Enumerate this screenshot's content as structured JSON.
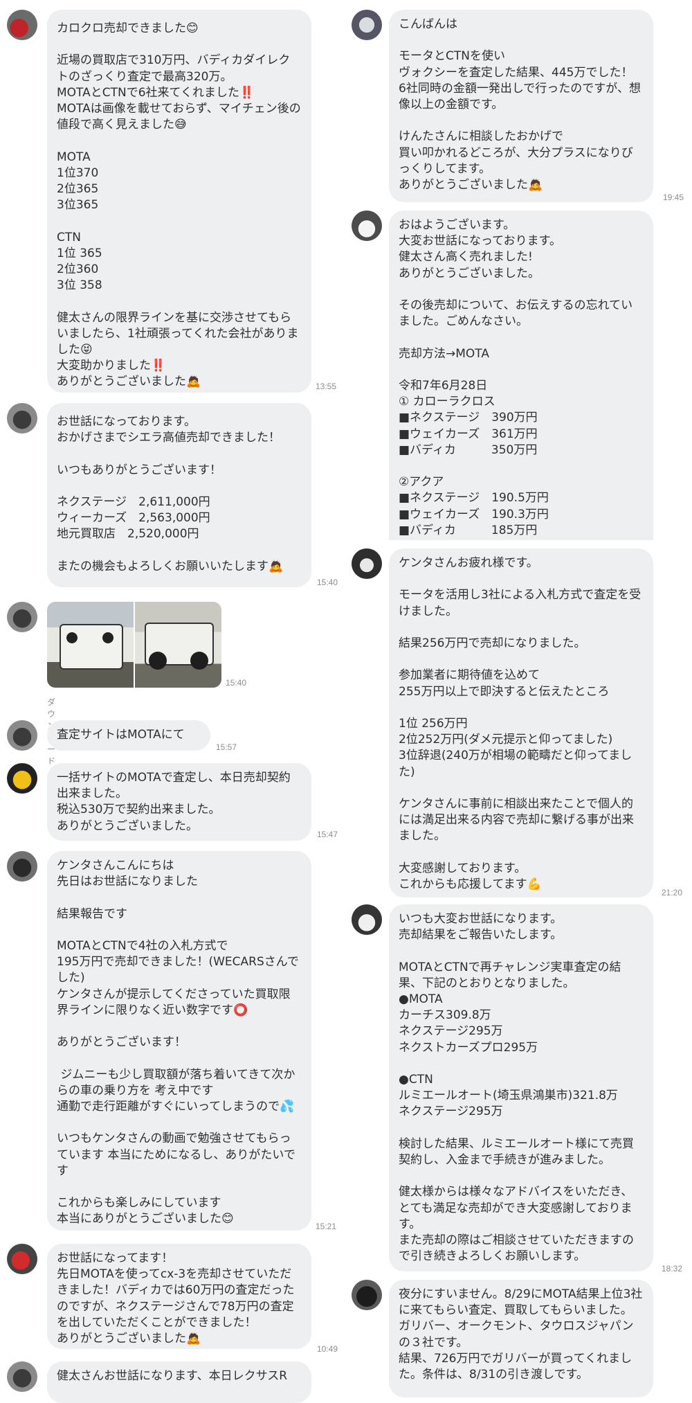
{
  "left": [
    {
      "avatar": "avatar-red-car",
      "text": "カロクロ売却できました😊\n\n近場の買取店で310万円、バディカダイレクトのざっくり査定で最高320万。\nMOTAとCTNで6社来てくれました‼️\nMOTAは画像を載せておらず、マイチェン後の値段で高く見えました😅\n\nMOTA\n1位370\n2位365\n3位365\n\nCTN\n1位 365\n2位360\n3位 358\n\n健太さんの限界ラインを基に交渉させてもらいましたら、1社頑張ってくれた会社がありました😝\n大変助かりました‼️\nありがとうございました🙇",
      "time": "13:55"
    },
    {
      "avatar": "avatar-dark-car",
      "text": "お世話になっております。\nおかげさまでシエラ高値売却できました！\n\nいつもありがとうございます！\n\nネクステージ　2,611,000円\nウィーカーズ　2,563,000円\n地元買取店　2,520,000円\n\nまたの機会もよろしくお願いいたします🙇",
      "time": "15:40"
    },
    {
      "avatar": "avatar-dark-car",
      "photos": [
        "jimny-front-photo",
        "jimny-side-photo"
      ],
      "time": "15:40",
      "download": "ダウンロード"
    },
    {
      "avatar": "avatar-dark-car",
      "text": "査定サイトはMOTAにて",
      "time": "15:57"
    },
    {
      "avatar": "avatar-yellow-car",
      "text": "一括サイトのMOTAで査定し、本日売却契約出来ました。\n税込530万で契約出来ました。\nありがとうございました。",
      "time": "15:47"
    },
    {
      "avatar": "avatar-black-car",
      "text": "ケンタさんこんにちは\n先日はお世話になりました\n\n結果報告です\n\nMOTAとCTNで4社の入札方式で\n195万円で売却できました！(WECARSさんでした)\nケンタさんが提示してくださっていた買取限界ラインに限りなく近い数字です⭕\n\nありがとうございます！\n\n ジムニーも少し買取額が落ち着いてきて次からの車の乗り方を 考え中です\n通勤で走行距離がすぐにいってしまうので💦\n\nいつもケンタさんの動画で勉強させてもらっています 本当にためになるし、ありがたいです\n\nこれからも楽しみにしています\n本当にありがとうございました😊",
      "time": "15:21"
    },
    {
      "avatar": "avatar-red-car",
      "text": "お世話になってます！\n先日MOTAを使ってcx-3を売却させていただきました！バディカでは60万円の査定だったのですが、ネクステージさんで78万円の査定を出していただくことができました！\nありがとうございました🙇",
      "time": "10:49"
    },
    {
      "avatar": "avatar-dark-car",
      "text": "健太さんお世話になります、本日レクサスR",
      "time": ""
    }
  ],
  "right": [
    {
      "avatar": "avatar-silver-car",
      "text": "こんばんは\n\nモータとCTNを使い\nヴォクシーを査定した結果、445万でした！\n6社同時の金額一発出しで行ったのですが、想像以上の金額です。\n\nけんたさんに相談したおかげで\n買い叩かれるどころが、大分プラスになりびっくりしてます。\nありがとうございました🙇",
      "time": "19:45"
    },
    {
      "avatar": "avatar-white-car",
      "text": "おはようございます。\n大変お世話になっております。\n健太さん高く売れました!\nありがとうございました。\n\nその後売却について、お伝えするの忘れていました。ごめんなさい。\n\n売却方法→MOTA\n\n令和7年6月28日\n① カローラクロス\n■ネクステージ　390万円\n■ウェイカーズ　361万円\n■バディカ　　　350万円\n\n②アクア\n■ネクステージ　190.5万円\n■ウェイカーズ　190.3万円\n■バディカ　　　185万円",
      "time": ""
    },
    {
      "avatar": "avatar-dark-car",
      "text": "ケンタさんお疲れ様です。\n\nモータを活用し3社による入札方式で査定を受けました。\n\n結果256万円で売却になりました。\n\n参加業者に期待値を込めて\n255万円以上で即決すると伝えたところ\n\n1位 256万円\n2位252万円(ダメ元提示と仰ってました)\n3位辞退(240万が相場の範疇だと仰ってました)\n\nケンタさんに事前に相談出来たことで個人的には満足出来る内容で売却に繋げる事が出来ました。\n\n大変感謝しております。\nこれからも応援してます💪",
      "time": "21:20"
    },
    {
      "avatar": "avatar-white-car",
      "text": "いつも大変お世話になります。\n売却結果をご報告いたします。\n\nMOTAとCTNで再チャレンジ実車査定の結果、下記のとおりとなりました。\n●MOTA\nカーチス309.8万\nネクステージ295万\nネクストカーズプロ295万\n\n●CTN\nルミエールオート(埼玉県鴻巣市)321.8万\nネクステージ295万\n\n検討した結果、ルミエールオート様にて売買契約し、入金まで手続きが進みました。\n\n健太様からは様々なアドバイスをいただき、とても満足な売却ができ大変感謝しております。\nまた売却の際はご相談させていただきますので引き続きよろしくお願いします。",
      "time": "18:32"
    },
    {
      "avatar": "avatar-black-car",
      "text": "夜分にすいません。8/29にMOTA結果上位3社に来てもらい査定、買取してもらいました。ガリバー、オークモント、タウロスジャパンの３社です。\n結果、726万円でガリバーが買ってくれました。条件は、8/31の引き渡しです。",
      "time": ""
    }
  ]
}
